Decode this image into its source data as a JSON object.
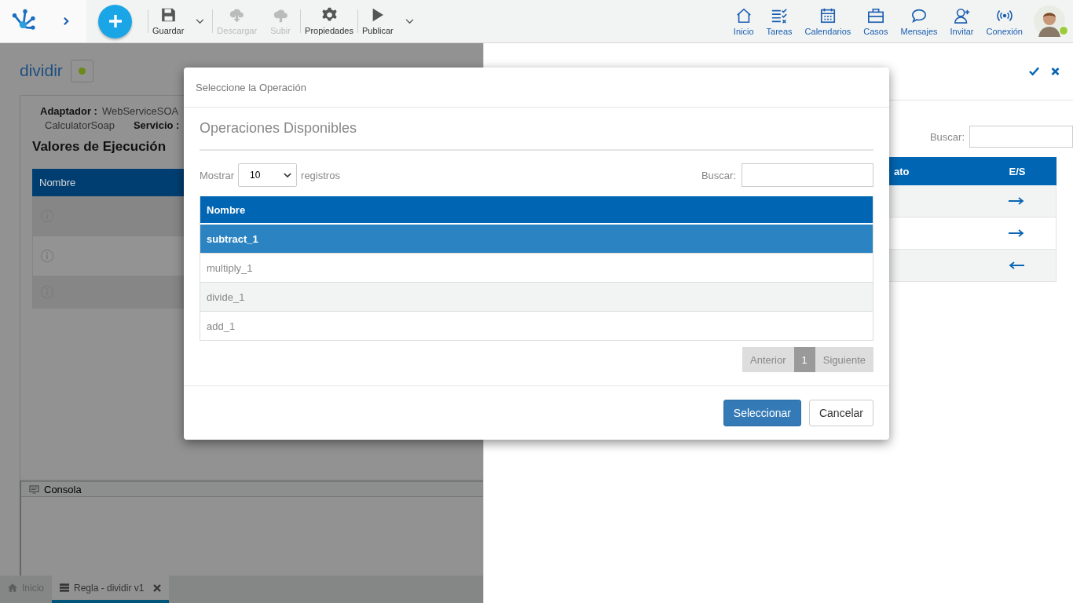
{
  "topbar": {
    "tools": [
      {
        "label": "Guardar",
        "disabled": false,
        "dropdown": true
      },
      {
        "label": "Descargar",
        "disabled": true,
        "dropdown": false
      },
      {
        "label": "Subir",
        "disabled": true,
        "dropdown": false
      },
      {
        "label": "Propiedades",
        "disabled": false,
        "dropdown": false
      },
      {
        "label": "Publicar",
        "disabled": false,
        "dropdown": true
      }
    ],
    "nav": [
      {
        "label": "Inicio"
      },
      {
        "label": "Tareas"
      },
      {
        "label": "Calendarios"
      },
      {
        "label": "Casos"
      },
      {
        "label": "Mensajes"
      },
      {
        "label": "Invitar"
      },
      {
        "label": "Conexión"
      }
    ],
    "user": {
      "online": true
    }
  },
  "editor": {
    "title": "dividir",
    "status_on": true,
    "adapter_label": "Adaptador :",
    "adapter_value": "WebServiceSOA",
    "port_value": "CalculatorSoap",
    "service_label": "Servicio :",
    "section_title": "Valores de Ejecución",
    "table": {
      "columns": [
        "Nombre"
      ],
      "rows": [
        {
          "shaded": true
        },
        {
          "shaded": false
        },
        {
          "shaded": true
        }
      ]
    }
  },
  "console": {
    "title": "Consola"
  },
  "bottom_tabs": [
    {
      "label": "Inicio",
      "selected": false,
      "closable": false
    },
    {
      "label": "Regla - dividir v1",
      "selected": true,
      "closable": true
    }
  ],
  "parameters_panel": {
    "search_label": "Buscar:",
    "columns": [
      "ato",
      "E/S"
    ],
    "rows": [
      {
        "kind": "input",
        "shaded": true
      },
      {
        "kind": "input",
        "shaded": false
      },
      {
        "kind": "output",
        "shaded": true
      }
    ]
  },
  "dialog": {
    "title": "Seleccione la Operación",
    "heading": "Operaciones Disponibles",
    "show_label": "Mostrar",
    "page_size": "10",
    "records_label": "registros",
    "search_label": "Buscar:",
    "columns": [
      "Nombre"
    ],
    "rows": [
      {
        "name": "subtract_1",
        "selected": true,
        "shaded": false
      },
      {
        "name": "multiply_1",
        "selected": false,
        "shaded": false
      },
      {
        "name": "divide_1",
        "selected": false,
        "shaded": true
      },
      {
        "name": "add_1",
        "selected": false,
        "shaded": false
      }
    ],
    "pagination": {
      "previous": "Anterior",
      "page": "1",
      "next": "Siguiente"
    },
    "buttons": [
      {
        "label": "Seleccionar",
        "kind": "primary"
      },
      {
        "label": "Cancelar",
        "kind": "default"
      }
    ]
  }
}
